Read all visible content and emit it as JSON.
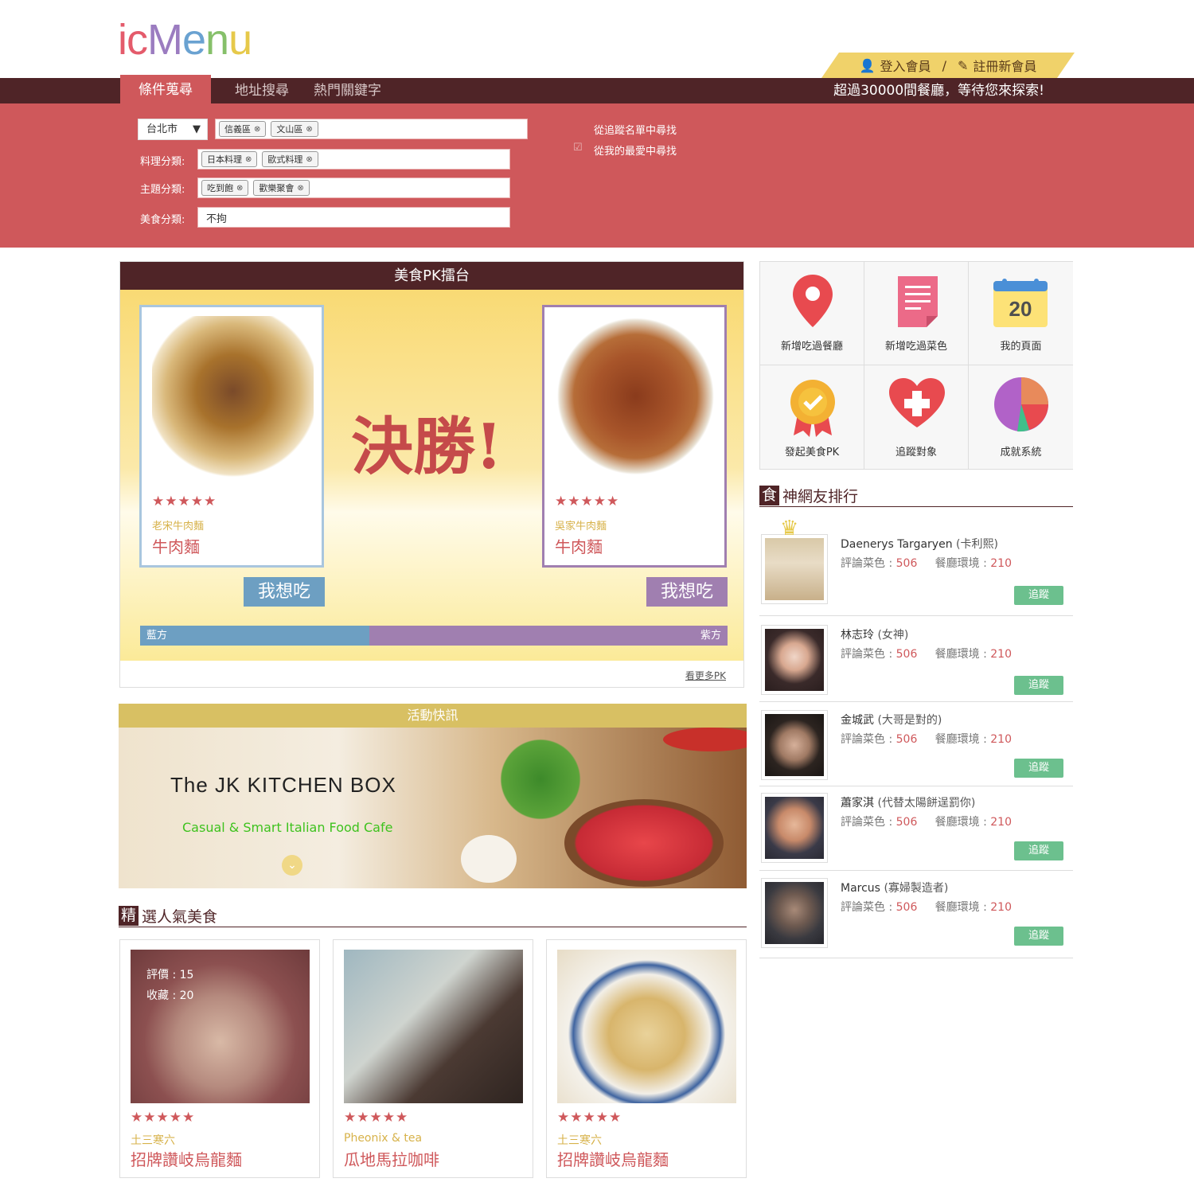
{
  "brand": {
    "logo_letters": [
      "i",
      "c",
      "M",
      "e",
      "n",
      "u"
    ]
  },
  "auth": {
    "login": "登入會員",
    "separator": "/",
    "register": "註冊新會員"
  },
  "nav": {
    "tabs": [
      "條件蒐尋",
      "地址搜尋",
      "熱門關鍵字"
    ],
    "slogan": "超過30000間餐廳，等待您來探索!"
  },
  "search": {
    "city": "台北市",
    "districts": [
      "信義區",
      "文山區"
    ],
    "cuisine_label": "料理分類:",
    "cuisine_tags": [
      "日本料理",
      "歐式料理"
    ],
    "theme_label": "主題分類:",
    "theme_tags": [
      "吃到飽",
      "歡樂聚會"
    ],
    "food_label": "美食分類:",
    "food_value": "不拘",
    "opt_follow": "從追蹤名單中尋找",
    "opt_favorite": "從我的最愛中尋找"
  },
  "pk": {
    "title": "美食PK擂台",
    "headline": "決勝!",
    "left": {
      "stars": "★★★★★",
      "restaurant": "老宋牛肉麵",
      "dish": "牛肉麵",
      "button": "我想吃"
    },
    "right": {
      "stars": "★★★★★",
      "restaurant": "吳家牛肉麵",
      "dish": "牛肉麵",
      "button": "我想吃"
    },
    "blue_label": "藍方",
    "purple_label": "紫方",
    "blue_share": 0.39,
    "more": "看更多PK"
  },
  "activity": {
    "title": "活動快訊",
    "banner_title": "The JK KITCHEN BOX",
    "banner_sub": "Casual & Smart Italian Food Cafe"
  },
  "featured": {
    "prefix": "精",
    "title": "選人氣美食",
    "items": [
      {
        "rating_label": "評價 : 15",
        "fav_label": "收藏 : 20",
        "stars": "★★★★★",
        "shop": "土三寒六",
        "name": "招牌讚岐烏龍麵"
      },
      {
        "stars": "★★★★★",
        "shop": "Pheonix & tea",
        "name": "瓜地馬拉咖啡"
      },
      {
        "stars": "★★★★★",
        "shop": "土三寒六",
        "name": "招牌讚岐烏龍麵"
      }
    ]
  },
  "quick": [
    {
      "label": "新增吃過餐廳",
      "icon": "map-pin-icon"
    },
    {
      "label": "新增吃過菜色",
      "icon": "document-icon"
    },
    {
      "label": "我的頁面",
      "icon": "calendar-icon",
      "day": "20"
    },
    {
      "label": "發起美食PK",
      "icon": "badge-icon"
    },
    {
      "label": "追蹤對象",
      "icon": "heart-plus-icon"
    },
    {
      "label": "成就系統",
      "icon": "pie-chart-icon"
    }
  ],
  "ranking": {
    "prefix": "食",
    "title": "神網友排行",
    "dish_label": "評論菜色 : ",
    "env_label": "餐廳環境 : ",
    "follow": "追蹤",
    "users": [
      {
        "name": "Daenerys Targaryen",
        "alias": "(卡利熙)",
        "dishes": "506",
        "env": "210"
      },
      {
        "name": "林志玲",
        "alias": "(女神)",
        "dishes": "506",
        "env": "210"
      },
      {
        "name": "金城武",
        "alias": "(大哥是對的)",
        "dishes": "506",
        "env": "210"
      },
      {
        "name": "蕭家淇",
        "alias": "(代替太陽餅逞罰你)",
        "dishes": "506",
        "env": "210"
      },
      {
        "name": "Marcus",
        "alias": "(寡婦製造者)",
        "dishes": "506",
        "env": "210"
      }
    ]
  },
  "colors": {
    "brand_red": "#cf585b",
    "dark": "#4f2427",
    "blue": "#6d9fc2",
    "purple": "#a07fb0",
    "gold": "#f0d26a",
    "green": "#6cc08e"
  }
}
